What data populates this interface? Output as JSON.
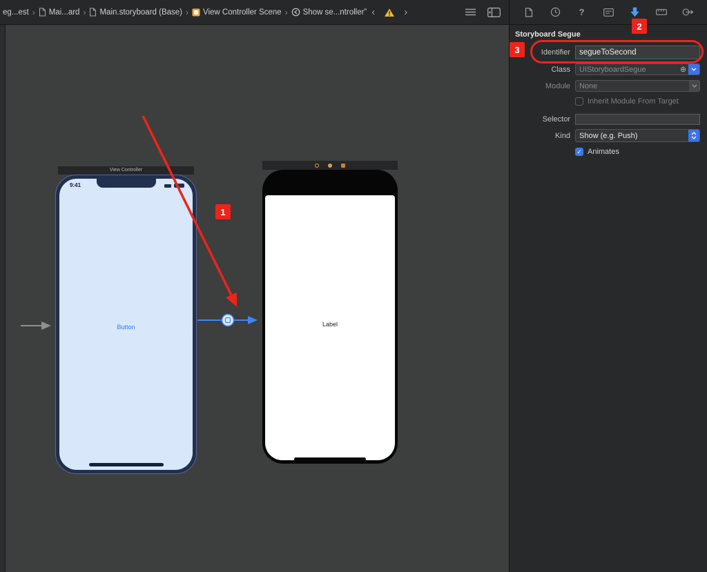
{
  "icons": {
    "check": "✓",
    "circle_plus": "⊕",
    "help": "?"
  },
  "breadcrumb": {
    "separator": "›",
    "back_arrow": "‹",
    "forward_arrow": "›",
    "items": [
      {
        "label": "eg...est"
      },
      {
        "label": "Mai...ard"
      },
      {
        "label": "Main.storyboard (Base)"
      },
      {
        "label": "View Controller Scene"
      },
      {
        "label": "Show se...ntroller”"
      }
    ]
  },
  "inspector": {
    "section_title": "Storyboard Segue",
    "identifier": {
      "label": "Identifier",
      "value": "segueToSecond"
    },
    "class": {
      "label": "Class",
      "value": "UIStoryboardSegue"
    },
    "module": {
      "label": "Module",
      "value": "None"
    },
    "inherit_checkbox": {
      "label": "Inherit Module From Target",
      "checked": false
    },
    "selector": {
      "label": "Selector",
      "value": ""
    },
    "kind": {
      "label": "Kind",
      "value": "Show (e.g. Push)"
    },
    "animates_checkbox": {
      "label": "Animates",
      "checked": true
    }
  },
  "canvas": {
    "left_vc": {
      "scene_title": "View Controller",
      "status_time": "9:41",
      "button_label": "Button"
    },
    "right_vc": {
      "label_text": "Label"
    }
  },
  "annotations": {
    "badge_1": "1",
    "badge_2": "2",
    "badge_3": "3"
  }
}
